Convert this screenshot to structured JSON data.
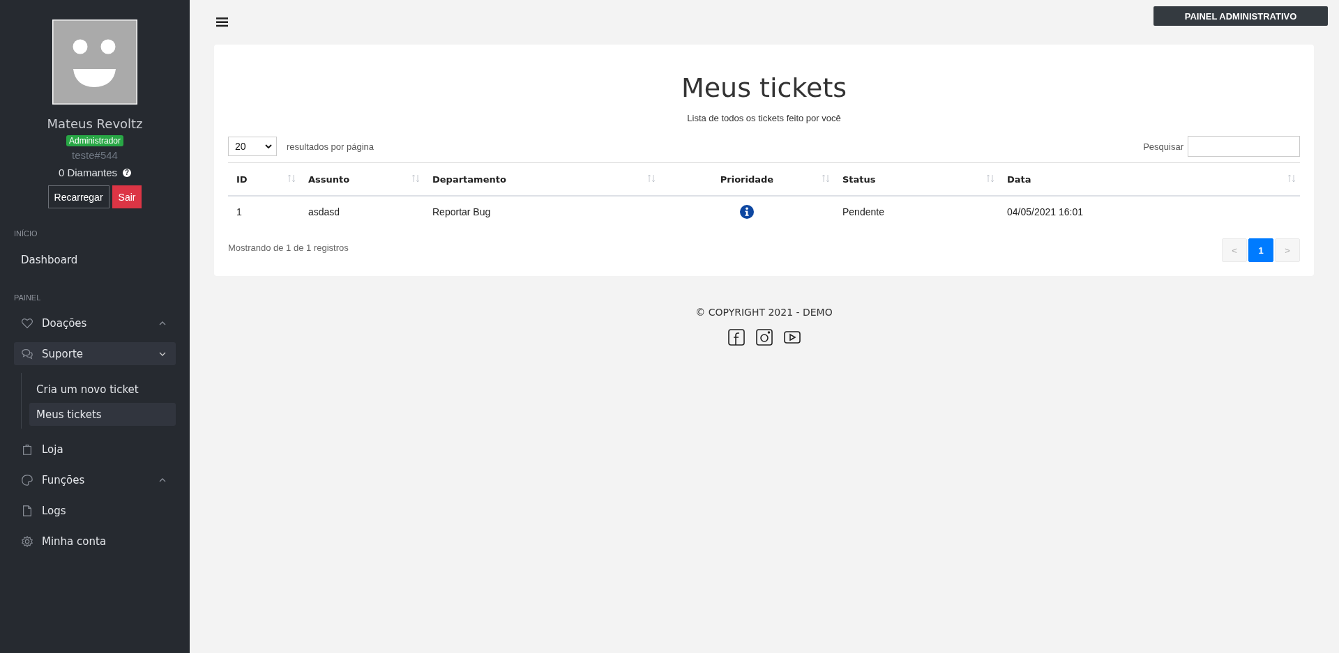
{
  "sidebar": {
    "profile": {
      "name": "Mateus Revoltz",
      "role": "Administrador",
      "tag": "teste#544",
      "diamonds": "0 Diamantes",
      "help": "?"
    },
    "buttons": [
      {
        "label": "Recarregar",
        "kind": "outline"
      },
      {
        "label": "Sair",
        "kind": "danger"
      }
    ],
    "sections": [
      {
        "heading": "INÍCIO",
        "items": [
          {
            "label": "Dashboard",
            "selected": false
          }
        ]
      },
      {
        "heading": "PAINEL",
        "items": [
          {
            "label": "Doações",
            "selected": false,
            "expanded": false
          },
          {
            "label": "Suporte",
            "selected": true,
            "expanded": true,
            "children": [
              {
                "label": "Cria um novo ticket",
                "selected": false
              },
              {
                "label": "Meus tickets",
                "selected": true
              }
            ]
          },
          {
            "label": "Loja",
            "selected": false
          },
          {
            "label": "Funções",
            "selected": false,
            "expanded": false
          },
          {
            "label": "Logs",
            "selected": false
          },
          {
            "label": "Minha conta",
            "selected": false
          }
        ]
      }
    ]
  },
  "topbar": {
    "button": "PAINEL ADMINISTRATIVO"
  },
  "page": {
    "title": "Meus tickets",
    "subtitle": "Lista de todos os tickets feito por você",
    "per_page": {
      "value": "20",
      "label": "resultados por página"
    },
    "search": {
      "label": "Pesquisar"
    },
    "table": {
      "columns": [
        "ID",
        "Assunto",
        "Departamento",
        "Prioridade",
        "Status",
        "Data"
      ],
      "rows": [
        {
          "id": "1",
          "subject": "asdasd",
          "department": "Reportar Bug",
          "priority": {
            "color": "#0d47a1"
          },
          "status": "Pendente",
          "date": "04/05/2021 16:01"
        }
      ]
    },
    "info": "Mostrando de 1 de 1 registros",
    "pagination": {
      "prev": {
        "label": "<",
        "disabled": true
      },
      "pages": [
        {
          "label": "1",
          "selected": true
        }
      ],
      "next": {
        "label": ">",
        "disabled": true
      }
    }
  },
  "footer": {
    "copyright": "© COPYRIGHT 2021 - DEMO"
  }
}
